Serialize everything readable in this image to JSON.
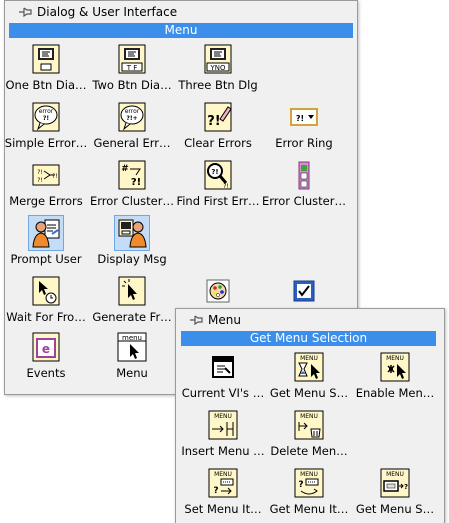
{
  "palette_main": {
    "title": "Dialog & User Interface",
    "section": "Menu",
    "items": [
      {
        "label": "One Btn Dia…",
        "icon": "one-button-dialog-icon"
      },
      {
        "label": "Two Btn Dia…",
        "icon": "two-button-dialog-icon"
      },
      {
        "label": "Three Btn Dlg",
        "icon": "three-button-dialog-icon"
      },
      {
        "label": "Simple Error…",
        "icon": "simple-error-handler-icon"
      },
      {
        "label": "General Err…",
        "icon": "general-error-handler-icon"
      },
      {
        "label": "Clear Errors",
        "icon": "clear-errors-icon"
      },
      {
        "label": "Error Ring",
        "icon": "error-ring-icon"
      },
      {
        "label": "Merge Errors",
        "icon": "merge-errors-icon"
      },
      {
        "label": "Error Cluster…",
        "icon": "error-cluster-from-code-icon"
      },
      {
        "label": "Find First Err…",
        "icon": "find-first-error-icon"
      },
      {
        "label": "Error Cluster…",
        "icon": "error-cluster-constant-icon"
      },
      {
        "label": "Prompt User",
        "icon": "prompt-user-icon"
      },
      {
        "label": "Display Msg",
        "icon": "display-message-icon"
      },
      {
        "label": "Wait For Fro…",
        "icon": "wait-for-front-panel-icon"
      },
      {
        "label": "Generate Fr…",
        "icon": "generate-front-panel-icon"
      },
      {
        "label": "",
        "icon": "color-palette-icon"
      },
      {
        "label": "",
        "icon": "checkbox-icon"
      },
      {
        "label": "Events",
        "icon": "events-icon"
      },
      {
        "label": "Menu",
        "icon": "menu-subpalette-icon"
      }
    ]
  },
  "palette_menu": {
    "title": "Menu",
    "section": "Get Menu Selection",
    "items": [
      {
        "label": "Current VI's …",
        "icon": "current-vi-menubar-icon"
      },
      {
        "label": "Get Menu S…",
        "icon": "get-menu-selection-icon"
      },
      {
        "label": "Enable Men…",
        "icon": "enable-menu-tracking-icon"
      },
      {
        "label": "Insert Menu …",
        "icon": "insert-menu-items-icon"
      },
      {
        "label": "Delete Men…",
        "icon": "delete-menu-items-icon"
      },
      {
        "label": "Set Menu It…",
        "icon": "set-menu-item-info-icon"
      },
      {
        "label": "Get Menu It…",
        "icon": "get-menu-item-info-icon"
      },
      {
        "label": "Get Menu S…",
        "icon": "get-menu-shortcut-info-icon"
      }
    ],
    "icon_text": {
      "menu": "MENU",
      "menu_lower": "menu",
      "tf": "T F",
      "yno": "YNO",
      "error": "error",
      "errq": "?!",
      "errq_plus": "?!+",
      "err_hash": "#",
      "e": "e"
    }
  }
}
